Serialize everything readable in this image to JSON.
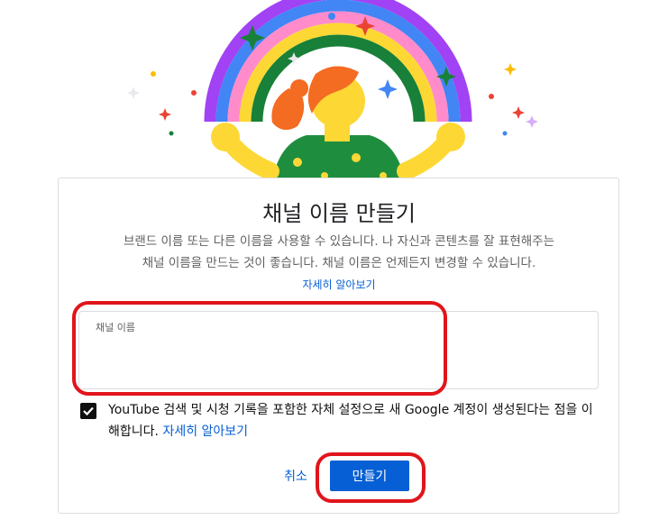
{
  "dialog": {
    "title": "채널 이름 만들기",
    "description_line1": "브랜드 이름 또는 다른 이름을 사용할 수 있습니다. 나 자신과 콘텐츠를 잘 표현해주는",
    "description_line2": "채널 이름을 만드는 것이 좋습니다. 채널 이름은 언제든지 변경할 수 있습니다.",
    "learn_more": "자세히 알아보기",
    "name_field": {
      "label": "채널 이름",
      "value": "",
      "placeholder": ""
    },
    "consent": {
      "checked": true,
      "text": "YouTube 검색 및 시청 기록을 포함한 자체 설정으로 새 Google 계정이 생성된다는 점을 이해합니다.",
      "link": "자세히 알아보기"
    },
    "cancel_label": "취소",
    "create_label": "만들기"
  },
  "icons": {
    "checkbox": "checkmark-icon",
    "illustration": "rainbow-celebration-illustration"
  },
  "colors": {
    "accent": "#065fd4",
    "annotation": "#e0151b",
    "text_secondary": "#606060"
  }
}
